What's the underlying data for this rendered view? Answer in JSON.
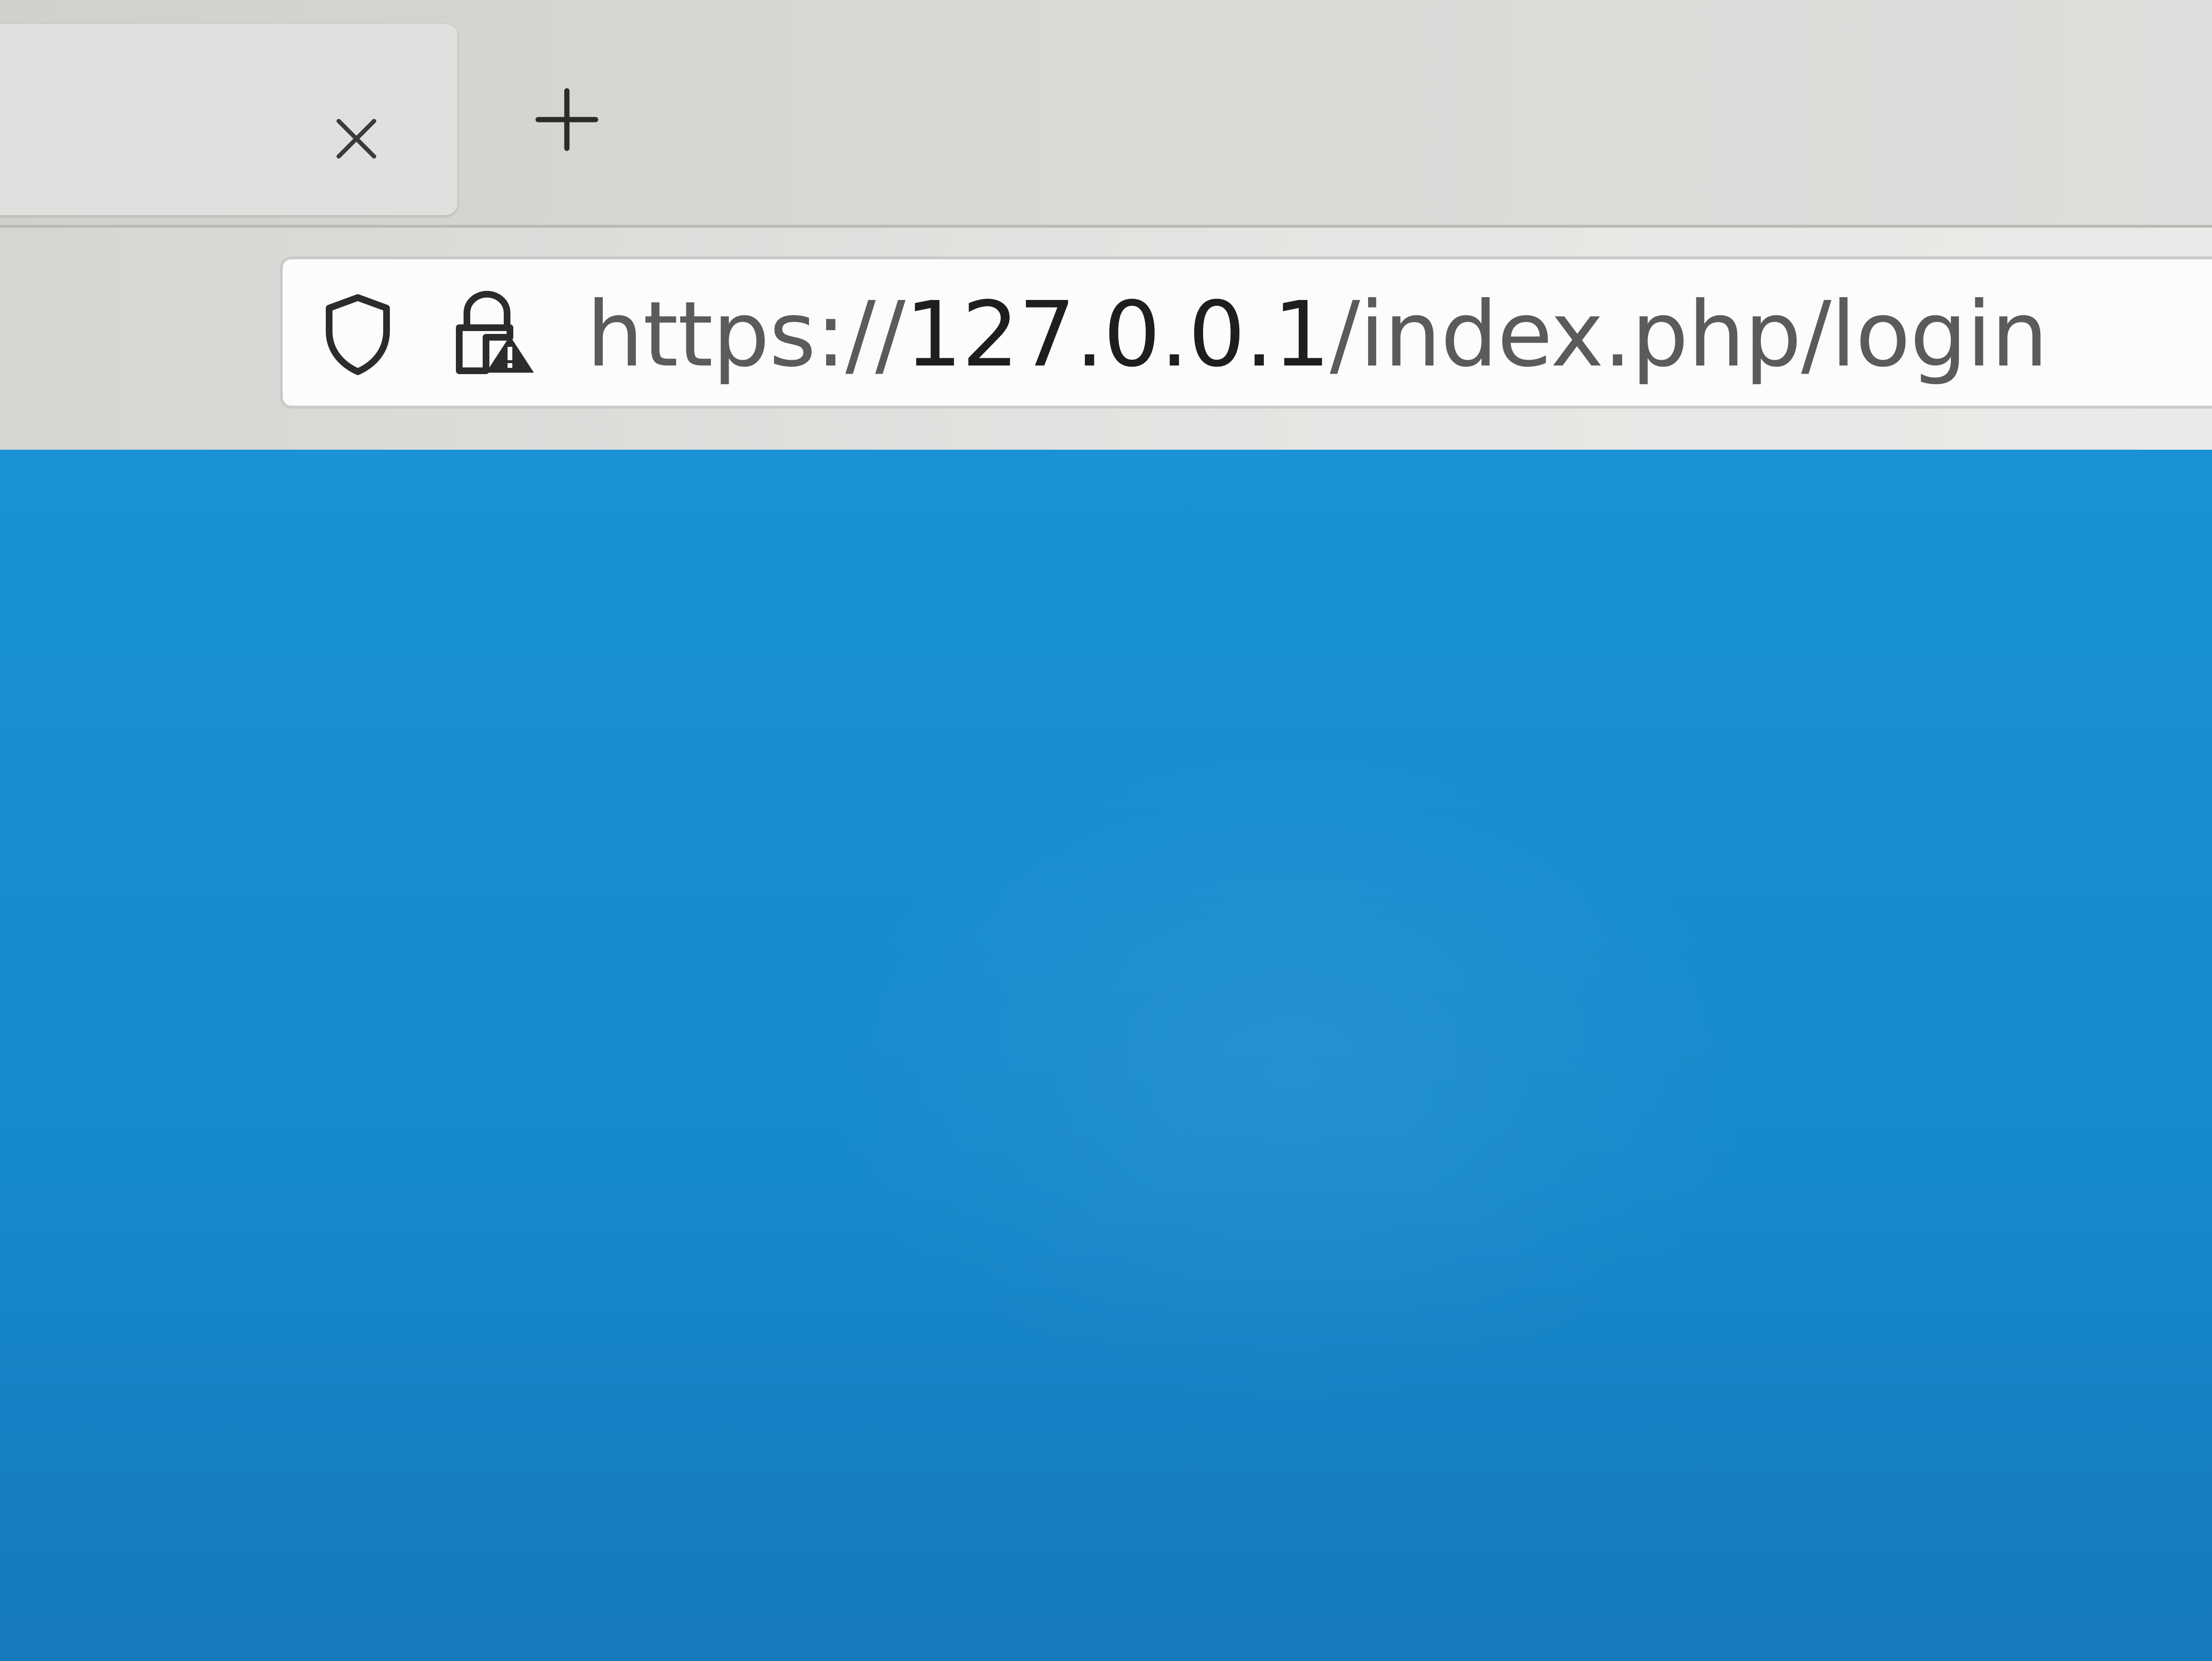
{
  "browser": {
    "tab": {
      "close_icon": "close-icon"
    },
    "new_tab_icon": "plus-icon",
    "address_bar": {
      "shield_icon": "shield-icon",
      "lock_icon": "lock-warning-icon",
      "url_scheme": "https://",
      "url_host": "127.0.0.1",
      "url_path": "/index.php/login"
    }
  },
  "page": {
    "background_color": "#1a8fd4"
  }
}
